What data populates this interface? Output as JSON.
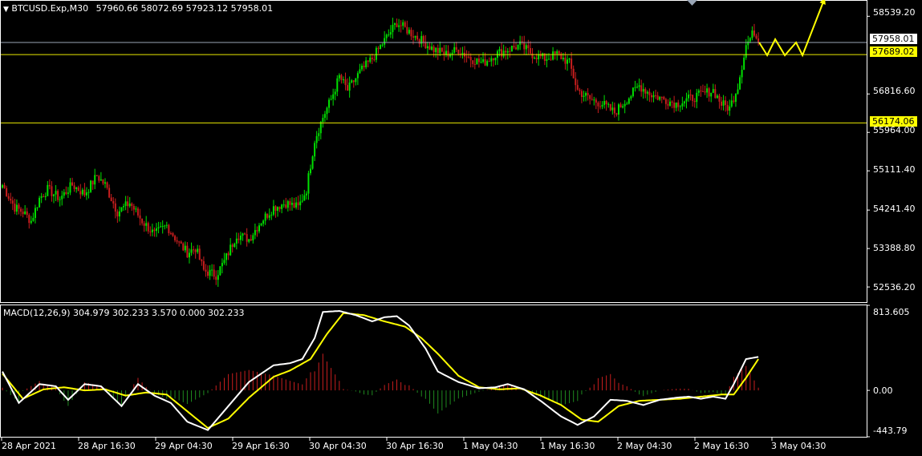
{
  "colors": {
    "bg": "#000000",
    "axis": "#ffffff",
    "bull": "#00e000",
    "bear": "#c81e1e",
    "yellow": "#ffff00",
    "bid_line": "#9aa6b6",
    "hline": "#e8e800"
  },
  "header": {
    "menu_icon": "triangle-down-icon",
    "symbol_tf": "BTCUSD.Exp,M30",
    "ohlc": "57960.66 58072.69 57923.12 57958.01"
  },
  "price_axis": {
    "ticks": [
      "58539.20",
      "56816.60",
      "55964.00",
      "55111.40",
      "54241.40",
      "53388.80",
      "52536.20"
    ]
  },
  "price_boxes": {
    "bid": "57958.01",
    "level_high": "57689.02",
    "level_low": "56174.06"
  },
  "macd": {
    "label": "MACD(12,26,9) 304.979 302.233 3.570 0.000 302.233",
    "ticks": [
      "813.605",
      "0.00",
      "-443.79"
    ]
  },
  "time_axis": {
    "labels": [
      "28 Apr 2021",
      "28 Apr 16:30",
      "29 Apr 04:30",
      "29 Apr 16:30",
      "30 Apr 04:30",
      "30 Apr 16:30",
      "1 May 04:30",
      "1 May 16:30",
      "2 May 04:30",
      "2 May 16:30",
      "3 May 04:30"
    ]
  },
  "chart_data": {
    "type": "candlestick",
    "symbol": "BTCUSD.Exp",
    "timeframe": "M30",
    "price_range": [
      52200,
      58900
    ],
    "horizontal_levels": [
      57689.02,
      56174.06
    ],
    "bid": 57958.01,
    "close_path_anchors": [
      [
        0,
        54800
      ],
      [
        6,
        54300
      ],
      [
        10,
        54200
      ],
      [
        14,
        54000
      ],
      [
        18,
        54500
      ],
      [
        22,
        54700
      ],
      [
        28,
        54500
      ],
      [
        34,
        54800
      ],
      [
        40,
        54600
      ],
      [
        46,
        55000
      ],
      [
        50,
        54800
      ],
      [
        56,
        54200
      ],
      [
        62,
        54400
      ],
      [
        68,
        54000
      ],
      [
        74,
        53700
      ],
      [
        80,
        53900
      ],
      [
        86,
        53500
      ],
      [
        90,
        53300
      ],
      [
        94,
        53400
      ],
      [
        98,
        52900
      ],
      [
        104,
        52800
      ],
      [
        108,
        53100
      ],
      [
        114,
        53700
      ],
      [
        120,
        53600
      ],
      [
        126,
        54000
      ],
      [
        132,
        54300
      ],
      [
        138,
        54400
      ],
      [
        144,
        54300
      ],
      [
        148,
        54700
      ],
      [
        152,
        55800
      ],
      [
        156,
        56300
      ],
      [
        160,
        56700
      ],
      [
        164,
        57200
      ],
      [
        168,
        56900
      ],
      [
        174,
        57300
      ],
      [
        180,
        57600
      ],
      [
        186,
        58000
      ],
      [
        192,
        58400
      ],
      [
        198,
        58200
      ],
      [
        204,
        58000
      ],
      [
        210,
        57800
      ],
      [
        216,
        57700
      ],
      [
        222,
        57800
      ],
      [
        228,
        57600
      ],
      [
        234,
        57500
      ],
      [
        240,
        57700
      ],
      [
        246,
        57800
      ],
      [
        252,
        57900
      ],
      [
        258,
        57700
      ],
      [
        264,
        57600
      ],
      [
        270,
        57700
      ],
      [
        276,
        57500
      ],
      [
        280,
        56900
      ],
      [
        286,
        56700
      ],
      [
        292,
        56600
      ],
      [
        298,
        56400
      ],
      [
        304,
        56700
      ],
      [
        310,
        57000
      ],
      [
        316,
        56800
      ],
      [
        322,
        56700
      ],
      [
        328,
        56600
      ],
      [
        334,
        56700
      ],
      [
        340,
        56800
      ],
      [
        346,
        56900
      ],
      [
        350,
        56600
      ],
      [
        354,
        56500
      ],
      [
        358,
        57000
      ],
      [
        362,
        57900
      ],
      [
        366,
        58200
      ],
      [
        368,
        57958
      ]
    ],
    "forecast_arrow": [
      [
        1,
        0
      ],
      [
        6,
        8
      ],
      [
        11,
        -2
      ],
      [
        17,
        8
      ],
      [
        24,
        0
      ],
      [
        28,
        8
      ],
      [
        42,
        -28
      ]
    ],
    "macd": {
      "range": [
        -443.79,
        813.605
      ],
      "main_anchors": [
        [
          0,
          180
        ],
        [
          8,
          -120
        ],
        [
          18,
          60
        ],
        [
          26,
          40
        ],
        [
          32,
          -90
        ],
        [
          40,
          60
        ],
        [
          48,
          40
        ],
        [
          58,
          -150
        ],
        [
          66,
          60
        ],
        [
          74,
          -50
        ],
        [
          82,
          -120
        ],
        [
          90,
          -300
        ],
        [
          100,
          -380
        ],
        [
          110,
          -150
        ],
        [
          120,
          80
        ],
        [
          132,
          240
        ],
        [
          140,
          260
        ],
        [
          146,
          300
        ],
        [
          152,
          500
        ],
        [
          156,
          750
        ],
        [
          164,
          760
        ],
        [
          172,
          720
        ],
        [
          180,
          660
        ],
        [
          186,
          700
        ],
        [
          192,
          710
        ],
        [
          198,
          620
        ],
        [
          206,
          400
        ],
        [
          212,
          180
        ],
        [
          222,
          80
        ],
        [
          232,
          20
        ],
        [
          240,
          30
        ],
        [
          246,
          60
        ],
        [
          254,
          10
        ],
        [
          262,
          -100
        ],
        [
          272,
          -250
        ],
        [
          280,
          -330
        ],
        [
          288,
          -250
        ],
        [
          296,
          -90
        ],
        [
          304,
          -100
        ],
        [
          312,
          -140
        ],
        [
          320,
          -90
        ],
        [
          328,
          -70
        ],
        [
          334,
          -60
        ],
        [
          340,
          -80
        ],
        [
          346,
          -60
        ],
        [
          352,
          -80
        ],
        [
          356,
          60
        ],
        [
          362,
          300
        ],
        [
          368,
          320
        ]
      ],
      "signal_anchors": [
        [
          0,
          160
        ],
        [
          10,
          -80
        ],
        [
          20,
          10
        ],
        [
          30,
          30
        ],
        [
          40,
          0
        ],
        [
          50,
          10
        ],
        [
          60,
          -50
        ],
        [
          70,
          -20
        ],
        [
          80,
          -40
        ],
        [
          90,
          -200
        ],
        [
          100,
          -360
        ],
        [
          110,
          -270
        ],
        [
          120,
          -70
        ],
        [
          132,
          130
        ],
        [
          140,
          190
        ],
        [
          150,
          300
        ],
        [
          158,
          540
        ],
        [
          166,
          740
        ],
        [
          176,
          720
        ],
        [
          186,
          660
        ],
        [
          196,
          610
        ],
        [
          204,
          500
        ],
        [
          212,
          350
        ],
        [
          222,
          140
        ],
        [
          232,
          30
        ],
        [
          242,
          10
        ],
        [
          252,
          20
        ],
        [
          262,
          -50
        ],
        [
          272,
          -140
        ],
        [
          282,
          -280
        ],
        [
          290,
          -300
        ],
        [
          300,
          -150
        ],
        [
          310,
          -100
        ],
        [
          320,
          -90
        ],
        [
          330,
          -80
        ],
        [
          340,
          -60
        ],
        [
          350,
          -40
        ],
        [
          356,
          -40
        ],
        [
          362,
          120
        ],
        [
          368,
          300
        ]
      ]
    }
  }
}
